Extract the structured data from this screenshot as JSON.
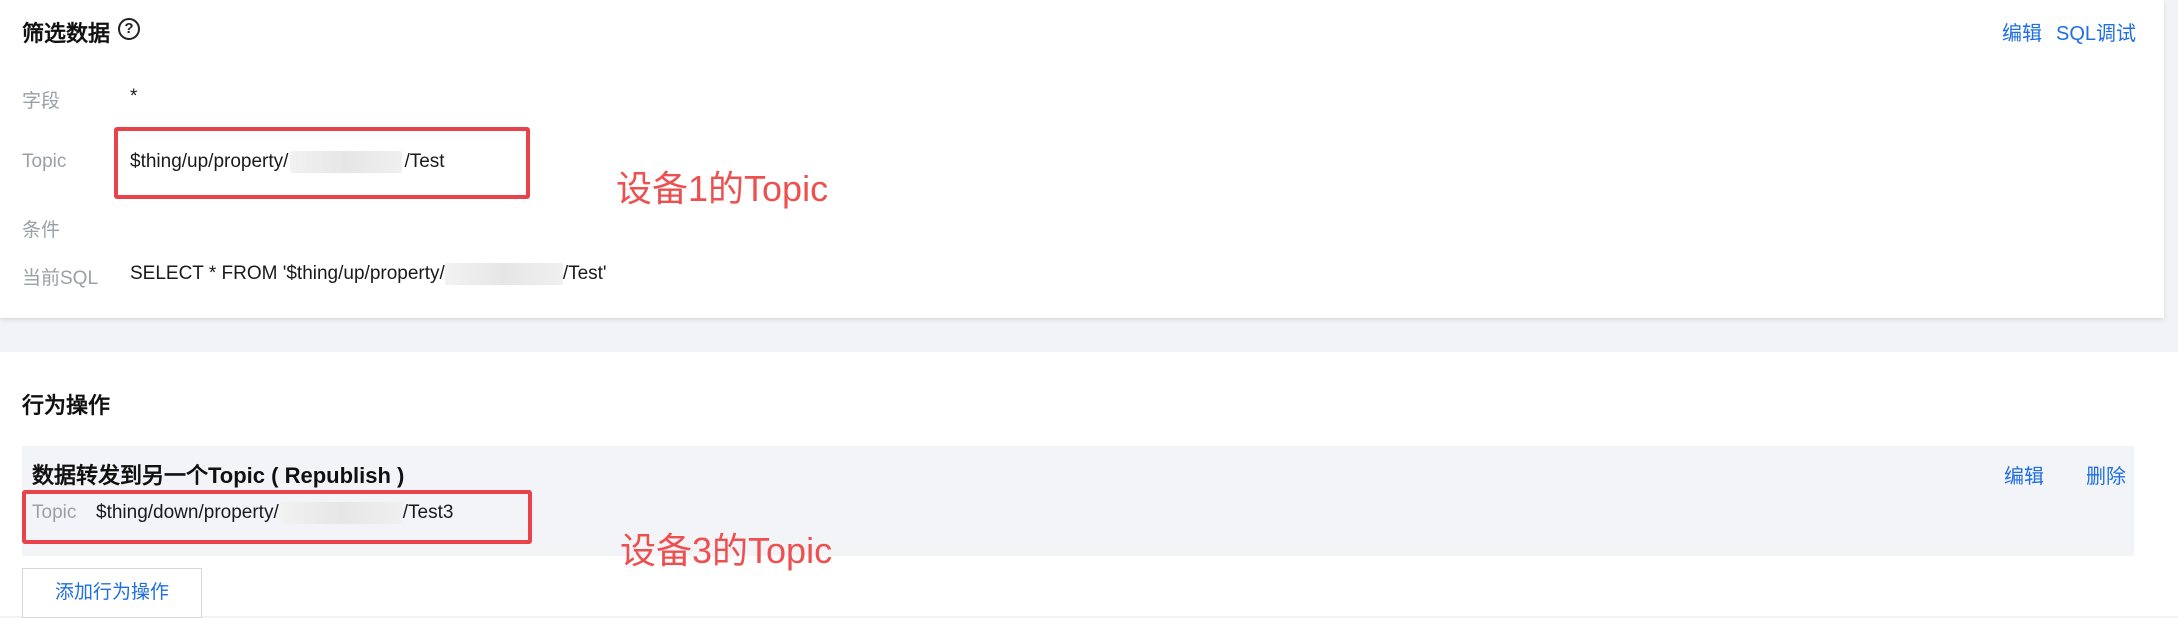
{
  "filter": {
    "title": "筛选数据",
    "help_icon": "question-circle-icon",
    "edit_label": "编辑",
    "sql_debug_label": "SQL调试",
    "field_label": "字段",
    "field_value": "*",
    "topic_label": "Topic",
    "topic_prefix": "$thing/up/property/",
    "topic_suffix": "/Test",
    "condition_label": "条件",
    "sql_label": "当前SQL",
    "sql_prefix": "SELECT * FROM '$thing/up/property/",
    "sql_suffix": "/Test'"
  },
  "annotations": {
    "device1": "设备1的Topic",
    "device3": "设备3的Topic"
  },
  "actions": {
    "title": "行为操作",
    "item": {
      "title": "数据转发到另一个Topic ( Republish )",
      "edit_label": "编辑",
      "delete_label": "删除",
      "topic_label": "Topic",
      "topic_prefix": "$thing/down/property/",
      "topic_suffix": "/Test3"
    },
    "add_button": "添加行为操作"
  },
  "colors": {
    "accent": "#1f6fe0",
    "annotation_red": "#e8434b"
  }
}
